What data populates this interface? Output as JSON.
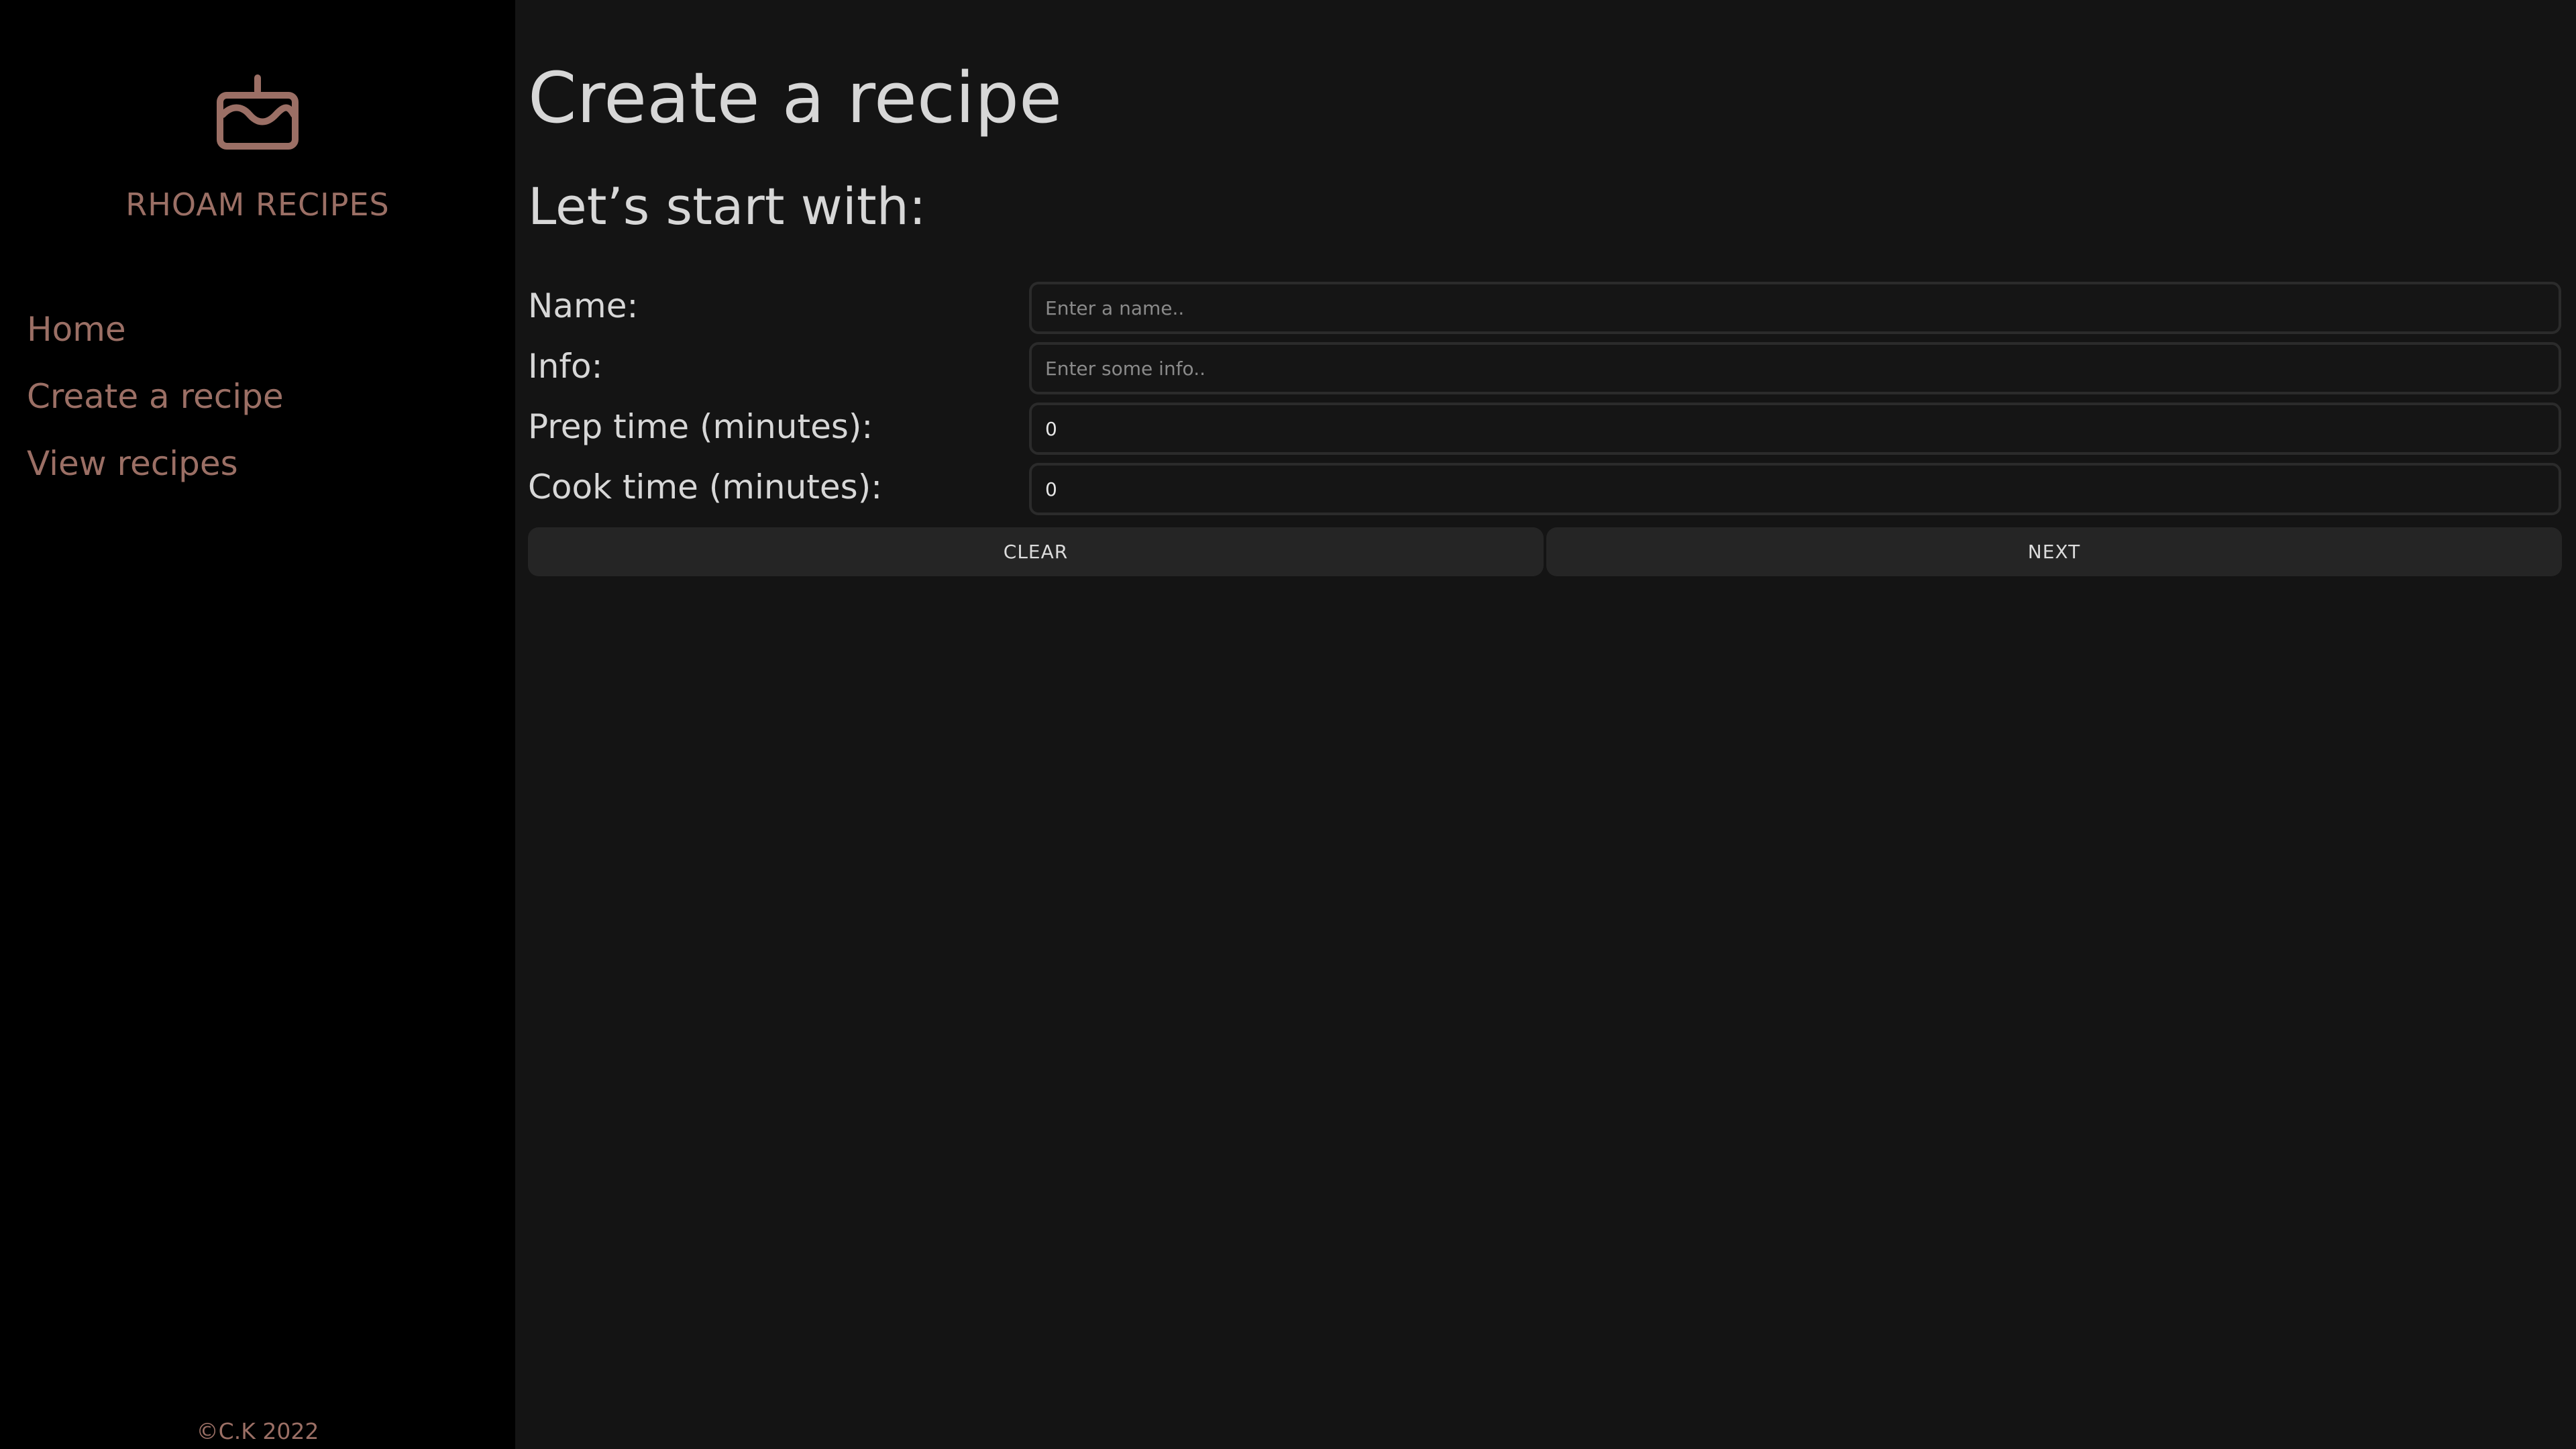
{
  "brand": {
    "name": "RHOAM RECIPES",
    "logo_icon": "cake-icon",
    "accent_color": "#9b6f65"
  },
  "sidebar": {
    "items": [
      {
        "label": "Home"
      },
      {
        "label": "Create a recipe"
      },
      {
        "label": "View recipes"
      }
    ],
    "copyright": "©C.K 2022"
  },
  "main": {
    "title": "Create a recipe",
    "section_title": "Let’s start with:",
    "fields": {
      "name": {
        "label": "Name:",
        "value": "",
        "placeholder": "Enter a name.."
      },
      "info": {
        "label": "Info:",
        "value": "",
        "placeholder": "Enter some info.."
      },
      "prep_time": {
        "label": "Prep time (minutes):",
        "value": "0",
        "placeholder": ""
      },
      "cook_time": {
        "label": "Cook time (minutes):",
        "value": "0",
        "placeholder": ""
      }
    },
    "buttons": {
      "clear": "CLEAR",
      "next": "NEXT"
    }
  },
  "colors": {
    "background_main": "#141414",
    "background_sidebar": "#000000",
    "text_primary": "#d7d7d7",
    "input_border": "#2b2b2b",
    "button_bg": "#252525"
  }
}
